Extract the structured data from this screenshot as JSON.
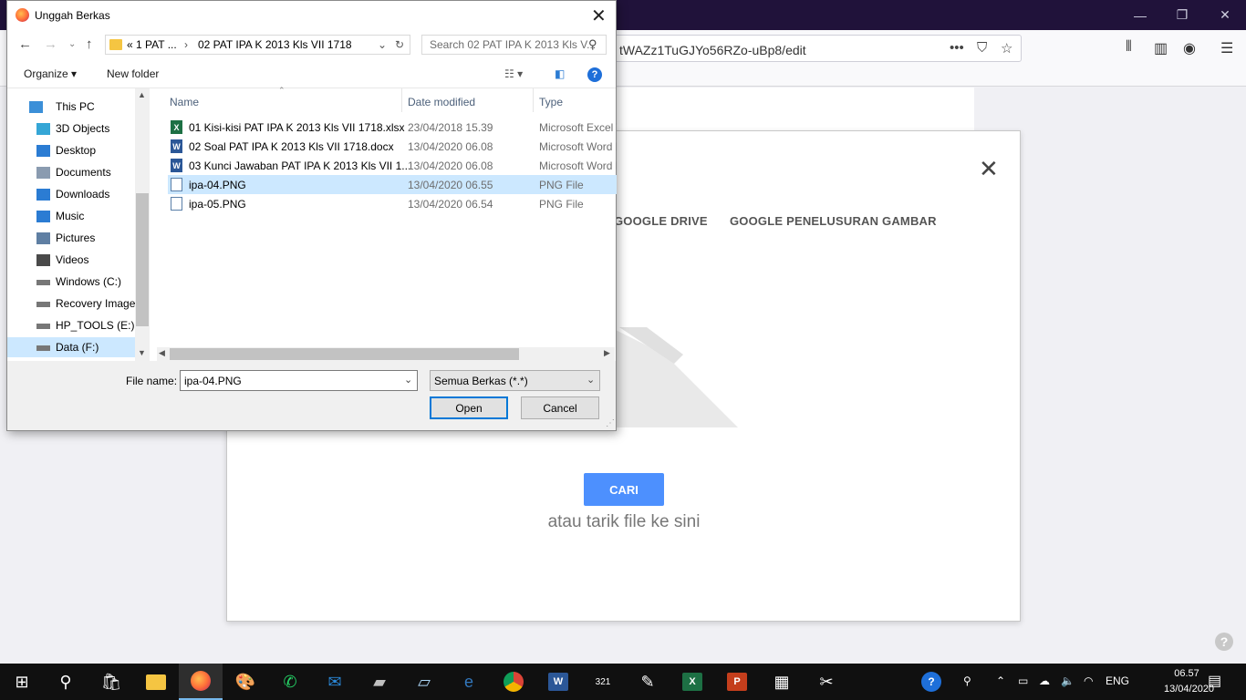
{
  "browser": {
    "url": "tWAZz1TuGJYo56RZo-uBp8/edit",
    "window_controls": {
      "minimize": "—",
      "restore": "❐",
      "close": "✕"
    }
  },
  "google_picker": {
    "tabs": [
      "GOOGLE DRIVE",
      "GOOGLE PENELUSURAN GAMBAR"
    ],
    "search_button": "CARI",
    "drag_text": "atau tarik file ke sini",
    "help": "?"
  },
  "file_dialog": {
    "title": "Unggah Berkas",
    "address": {
      "part1": "«  1 PAT ...",
      "sep": "›",
      "part2": "02 PAT IPA K 2013 Kls VII 1718"
    },
    "search_placeholder": "Search 02 PAT IPA K 2013 Kls V...",
    "toolbar": {
      "organize": "Organize ▾",
      "new_folder": "New folder"
    },
    "nav": [
      {
        "label": "This PC",
        "icon": "pc-icon",
        "color": "#3b8fd8"
      },
      {
        "label": "3D Objects",
        "icon": "cube-icon",
        "color": "#35a6d6"
      },
      {
        "label": "Desktop",
        "icon": "desktop-icon",
        "color": "#2b7cd3"
      },
      {
        "label": "Documents",
        "icon": "document-icon",
        "color": "#8a9bb0"
      },
      {
        "label": "Downloads",
        "icon": "download-icon",
        "color": "#2b7cd3"
      },
      {
        "label": "Music",
        "icon": "music-icon",
        "color": "#2b7cd3"
      },
      {
        "label": "Pictures",
        "icon": "pictures-icon",
        "color": "#5f7fa3"
      },
      {
        "label": "Videos",
        "icon": "video-icon",
        "color": "#4a4a4a"
      },
      {
        "label": "Windows (C:)",
        "icon": "drive-icon",
        "color": "#777"
      },
      {
        "label": "Recovery Image",
        "icon": "drive-icon",
        "color": "#777"
      },
      {
        "label": "HP_TOOLS (E:)",
        "icon": "drive-icon",
        "color": "#777"
      },
      {
        "label": "Data (F:)",
        "icon": "drive-icon",
        "color": "#777"
      }
    ],
    "columns": {
      "name": "Name",
      "date": "Date modified",
      "type": "Type"
    },
    "files": [
      {
        "name": "01 Kisi-kisi PAT IPA K 2013 Kls VII 1718.xlsx",
        "date": "23/04/2018 15.39",
        "type": "Microsoft Excel W",
        "icon": "excel-icon",
        "badge": "X",
        "color": "#1d7044"
      },
      {
        "name": "02 Soal PAT IPA K 2013 Kls VII 1718.docx",
        "date": "13/04/2020 06.08",
        "type": "Microsoft Word D",
        "icon": "word-icon",
        "badge": "W",
        "color": "#2b5797"
      },
      {
        "name": "03 Kunci Jawaban PAT IPA K 2013 Kls VII 1...",
        "date": "13/04/2020 06.08",
        "type": "Microsoft Word D",
        "icon": "word-icon",
        "badge": "W",
        "color": "#2b5797"
      },
      {
        "name": "ipa-04.PNG",
        "date": "13/04/2020 06.55",
        "type": "PNG File",
        "icon": "image-file-icon",
        "badge": "",
        "color": "#5a7fa8"
      },
      {
        "name": "ipa-05.PNG",
        "date": "13/04/2020 06.54",
        "type": "PNG File",
        "icon": "image-file-icon",
        "badge": "",
        "color": "#5a7fa8"
      }
    ],
    "file_name_label": "File name:",
    "file_name_value": "ipa-04.PNG",
    "filter_value": "Semua Berkas (*.*)",
    "open_label": "Open",
    "cancel_label": "Cancel"
  },
  "taskbar": {
    "apps": [
      {
        "name": "start",
        "glyph": "⊞",
        "color": "#ffffff"
      },
      {
        "name": "search",
        "glyph": "⚲",
        "color": "#ffffff"
      },
      {
        "name": "store",
        "glyph": "🛍",
        "color": "#ffffff"
      },
      {
        "name": "file-explorer",
        "glyph": "",
        "color": "#f5c542"
      },
      {
        "name": "firefox",
        "glyph": "",
        "color": "#ff7139"
      },
      {
        "name": "paint",
        "glyph": "🎨",
        "color": "#ffffff"
      },
      {
        "name": "whatsapp",
        "glyph": "✆",
        "color": "#25d366"
      },
      {
        "name": "mail",
        "glyph": "✉",
        "color": "#2b88d8"
      },
      {
        "name": "scanner",
        "glyph": "▰",
        "color": "#c0c0c0"
      },
      {
        "name": "notes",
        "glyph": "▱",
        "color": "#aad4f5"
      },
      {
        "name": "edge",
        "glyph": "e",
        "color": "#3277bc"
      },
      {
        "name": "chrome",
        "glyph": "",
        "color": "#4285f4"
      },
      {
        "name": "word",
        "glyph": "W",
        "color": "#2b5797"
      },
      {
        "name": "calendar",
        "glyph": "321",
        "color": "#ffffff"
      },
      {
        "name": "notepad",
        "glyph": "✎",
        "color": "#ffffff"
      },
      {
        "name": "excel",
        "glyph": "X",
        "color": "#1d7044"
      },
      {
        "name": "powerpoint",
        "glyph": "P",
        "color": "#c43e1c"
      },
      {
        "name": "calculator",
        "glyph": "▦",
        "color": "#ffffff"
      },
      {
        "name": "snipping-tool",
        "glyph": "✂",
        "color": "#ffffff"
      }
    ],
    "language": "ENG",
    "time": "06.57",
    "date": "13/04/2020"
  }
}
